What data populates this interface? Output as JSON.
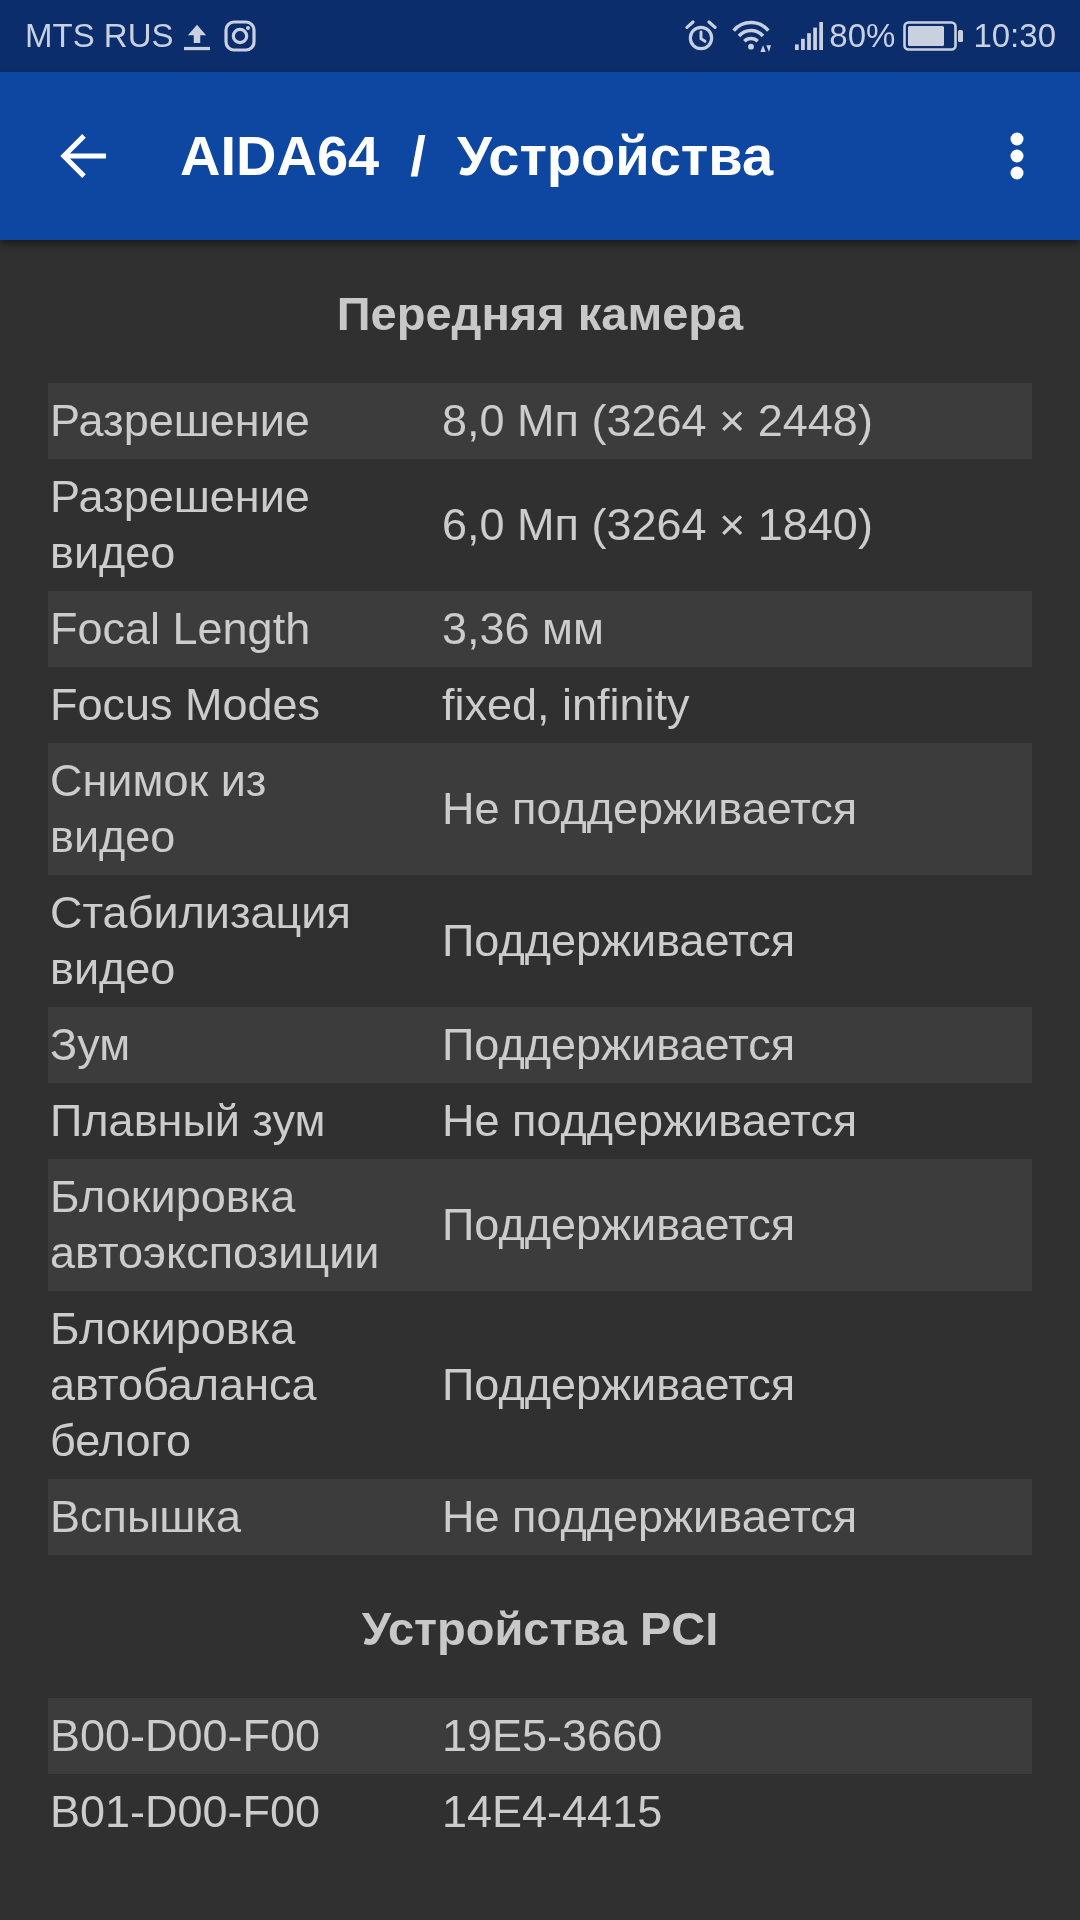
{
  "status_bar": {
    "carrier": "MTS RUS",
    "battery": "80%",
    "time": "10:30"
  },
  "app_bar": {
    "title": "AIDA64  /  Устройства"
  },
  "sections": [
    {
      "title": "Передняя камера",
      "rows": [
        {
          "label": "Разрешение",
          "value": "8,0 Мп (3264 × 2448)"
        },
        {
          "label": "Разрешение видео",
          "value": "6,0 Мп (3264 × 1840)"
        },
        {
          "label": "Focal Length",
          "value": "3,36 мм"
        },
        {
          "label": "Focus Modes",
          "value": "fixed, infinity"
        },
        {
          "label": "Снимок из видео",
          "value": "Не поддерживается"
        },
        {
          "label": "Стабилизация видео",
          "value": "Поддерживается"
        },
        {
          "label": "Зум",
          "value": "Поддерживается"
        },
        {
          "label": "Плавный зум",
          "value": "Не поддерживается"
        },
        {
          "label": "Блокировка автоэкспозиции",
          "value": "Поддерживается"
        },
        {
          "label": "Блокировка автобаланса белого",
          "value": "Поддерживается"
        },
        {
          "label": "Вспышка",
          "value": "Не поддерживается"
        }
      ]
    },
    {
      "title": "Устройства PCI",
      "rows": [
        {
          "label": "B00-D00-F00",
          "value": "19E5-3660"
        },
        {
          "label": "B01-D00-F00",
          "value": "14E4-4415"
        }
      ]
    }
  ]
}
